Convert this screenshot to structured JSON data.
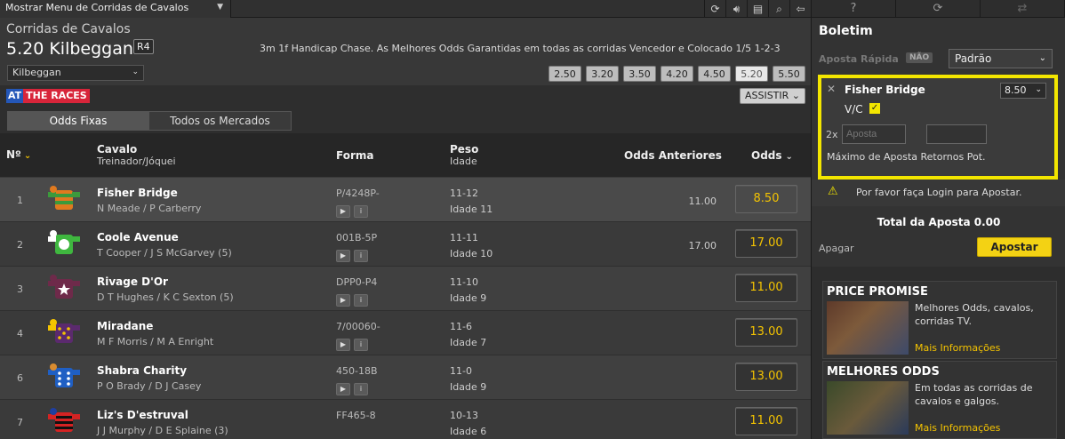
{
  "topbar": {
    "menu_label": "Mostrar Menu de Corridas de Cavalos",
    "tools": [
      "refresh-icon",
      "sound-icon",
      "print-icon",
      "search-icon",
      "back-icon"
    ]
  },
  "race": {
    "category_label": "Corridas de Cavalos",
    "title": "5.20 Kilbeggan",
    "badge": "R4",
    "description": "3m 1f Handicap Chase. As Melhores Odds Garantidas em todas as corridas Vencedor e Colocado 1/5 1-2-3",
    "venue": "Kilbeggan",
    "times": [
      "2.50",
      "3.20",
      "3.50",
      "4.20",
      "4.50",
      "5.20",
      "5.50"
    ],
    "active_time": "5.20"
  },
  "atr": {
    "logo_at": "AT",
    "logo_tr": "THE RACES",
    "watch_label": "ASSISTIR"
  },
  "tabs": [
    {
      "label": "Odds Fixas"
    },
    {
      "label": "Todos os Mercados"
    }
  ],
  "columns": {
    "no": "Nº",
    "horse": "Cavalo",
    "horse_sub": "Treinador/Jóquei",
    "form": "Forma",
    "weight": "Peso",
    "weight_sub": "Idade",
    "prev_odds": "Odds Anteriores",
    "odds": "Odds"
  },
  "runners": [
    {
      "no": "1",
      "horse": "Fisher Bridge",
      "people": "N Meade / P Carberry",
      "form": "P/4248P-",
      "weight": "11-12",
      "age": "Idade 11",
      "prev": "11.00",
      "odds": "8.50",
      "silk": "silk-green-orange-stripes"
    },
    {
      "no": "2",
      "horse": "Coole Avenue",
      "people": "T Cooper / J S McGarvey (5)",
      "form": "001B-5P",
      "weight": "11-11",
      "age": "Idade 10",
      "prev": "17.00",
      "odds": "17.00",
      "silk": "silk-green-white-spot"
    },
    {
      "no": "3",
      "horse": "Rivage D'Or",
      "people": "D T Hughes / K C Sexton (5)",
      "form": "DPP0-P4",
      "weight": "11-10",
      "age": "Idade 9",
      "prev": "",
      "odds": "11.00",
      "silk": "silk-maroon-white-star"
    },
    {
      "no": "4",
      "horse": "Miradane",
      "people": "M F Morris / M A Enright",
      "form": "7/00060-",
      "weight": "11-6",
      "age": "Idade 7",
      "prev": "",
      "odds": "13.00",
      "silk": "silk-purple-yellow-stars"
    },
    {
      "no": "6",
      "horse": "Shabra Charity",
      "people": "P O Brady / D J Casey",
      "form": "450-18B",
      "weight": "11-0",
      "age": "Idade 9",
      "prev": "",
      "odds": "13.00",
      "silk": "silk-blue-white-spots"
    },
    {
      "no": "7",
      "horse": "Liz's D'estruval",
      "people": "J J Murphy / D E Splaine (3)",
      "form": "FF465-8",
      "weight": "10-13",
      "age": "Idade 6",
      "prev": "",
      "odds": "11.00",
      "silk": "silk-red-black-hoops"
    }
  ],
  "betslip": {
    "title": "Boletim",
    "quick_bet": "Aposta Rápida",
    "quick_toggle": "NÃO",
    "mode": "Padrão",
    "selection": {
      "horse": "Fisher Bridge",
      "odds": "8.50",
      "type": "V/C",
      "multiplier": "2x",
      "stake_placeholder": "Aposta",
      "max_label": "Máximo de Aposta",
      "returns_label": "Retornos Pot."
    },
    "warning": "Por favor faça Login para Apostar.",
    "total": "Total da Aposta 0.00",
    "clear": "Apagar",
    "bet": "Apostar"
  },
  "promos": [
    {
      "title": "PRICE PROMISE",
      "text": "Melhores Odds, cavalos, corridas TV.",
      "link": "Mais Informações"
    },
    {
      "title": "MELHORES ODDS",
      "text": "Em todas as corridas de cavalos e galgos.",
      "link": "Mais Informações"
    }
  ],
  "colors": {
    "accent": "#f5c400",
    "slip_border": "#f3e600",
    "atr_blue": "#2457b8",
    "atr_red": "#d8253a"
  }
}
